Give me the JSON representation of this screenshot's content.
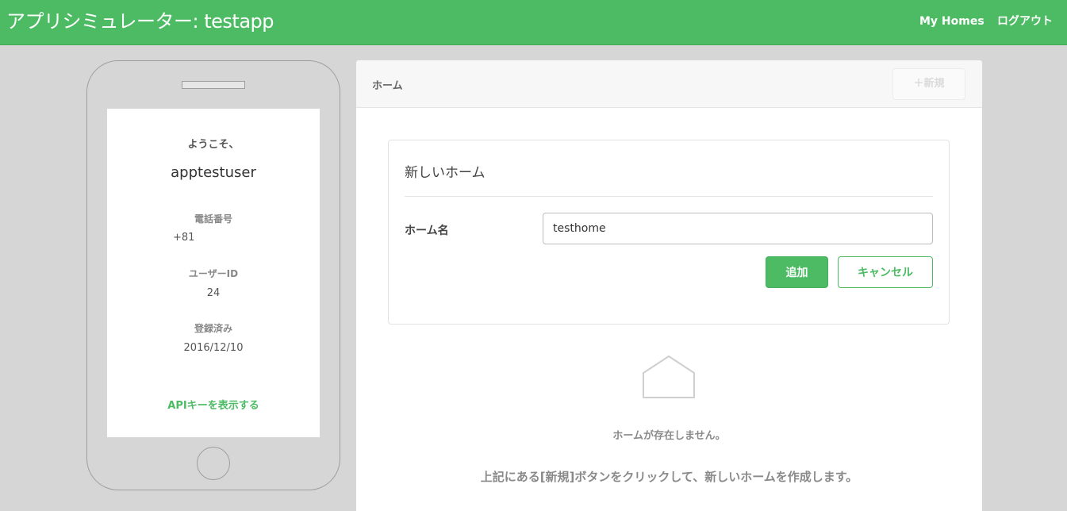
{
  "header": {
    "app_title": "アプリシミュレーター: testapp",
    "nav_my_homes": "My Homes",
    "nav_logout": "ログアウト"
  },
  "phone": {
    "welcome": "ようこそ、",
    "username": "apptestuser",
    "phone_label": "電話番号",
    "phone_value": "+81",
    "user_id_label": "ユーザーID",
    "user_id_value": "24",
    "registered_label": "登録済み",
    "registered_value": "2016/12/10",
    "api_key_link": "APIキーを表示する"
  },
  "panel": {
    "title": "ホーム",
    "new_button": "＋新規",
    "form": {
      "title": "新しいホーム",
      "home_name_label": "ホーム名",
      "home_name_value": "testhome",
      "add_button": "追加",
      "cancel_button": "キャンセル"
    },
    "empty": {
      "icon": "house-outline-icon",
      "title": "ホームが存在しません。",
      "description": "上記にある[新規]ボタンをクリックして、新しいホームを作成します。"
    }
  },
  "colors": {
    "brand_green": "#4cbb63",
    "background": "#d6d6d6"
  }
}
